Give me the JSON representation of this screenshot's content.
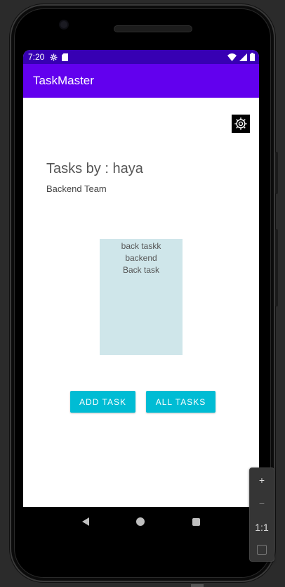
{
  "status_bar": {
    "time": "7:20",
    "left_icons": [
      "settings-icon",
      "sd-card-icon"
    ],
    "right_icons": [
      "wifi-icon",
      "signal-icon",
      "battery-icon"
    ],
    "color": "#3700b3"
  },
  "app_bar": {
    "title": "TaskMaster",
    "color": "#6200ee"
  },
  "settings_button": {
    "icon": "gear-icon"
  },
  "main": {
    "tasks_title": "Tasks by : haya",
    "team": "Backend Team",
    "task_card": {
      "title": "back taskk",
      "body": "backend",
      "state": "Back task",
      "color": "#cfe6ea"
    },
    "buttons": {
      "add_task": "ADD TASK",
      "all_tasks": "ALL TASKS",
      "color": "#00bcd4"
    }
  },
  "nav_bar": {
    "back": "back-icon",
    "home": "home-icon",
    "recents": "recents-icon"
  },
  "zoom_panel": {
    "zoom_in": "+",
    "zoom_out": "−",
    "actual_size": "1:1",
    "fit": "fit-screen-icon"
  }
}
